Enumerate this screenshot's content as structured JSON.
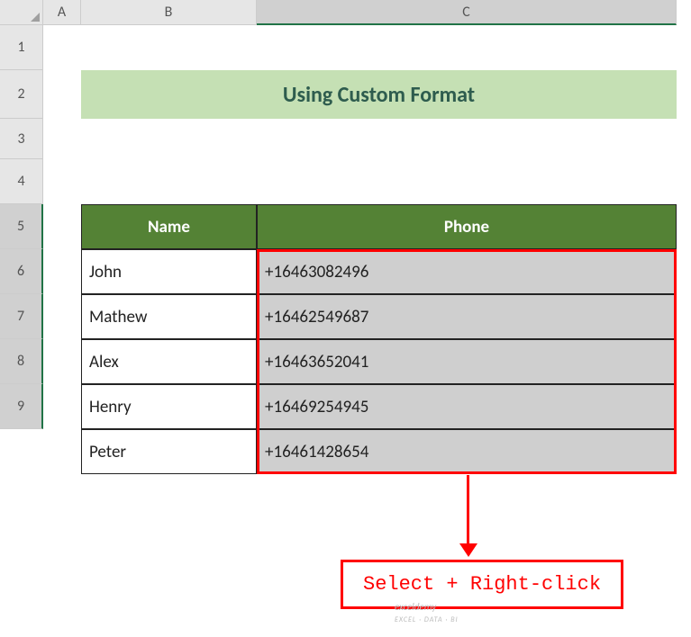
{
  "columns": {
    "A": "A",
    "B": "B",
    "C": "C"
  },
  "rows": {
    "r1": "1",
    "r2": "2",
    "r3": "3",
    "r4": "4",
    "r5": "5",
    "r6": "6",
    "r7": "7",
    "r8": "8",
    "r9": "9"
  },
  "title": "Using Custom Format",
  "headers": {
    "name": "Name",
    "phone": "Phone"
  },
  "data": [
    {
      "name": "John",
      "phone": "+16463082496"
    },
    {
      "name": "Mathew",
      "phone": "+16462549687"
    },
    {
      "name": "Alex",
      "phone": "+16463652041"
    },
    {
      "name": "Henry",
      "phone": "+16469254945"
    },
    {
      "name": "Peter",
      "phone": "+16461428654"
    }
  ],
  "callout": "Select + Right-click",
  "watermark": {
    "brand": "exceldemy",
    "tag": "EXCEL · DATA · BI"
  }
}
